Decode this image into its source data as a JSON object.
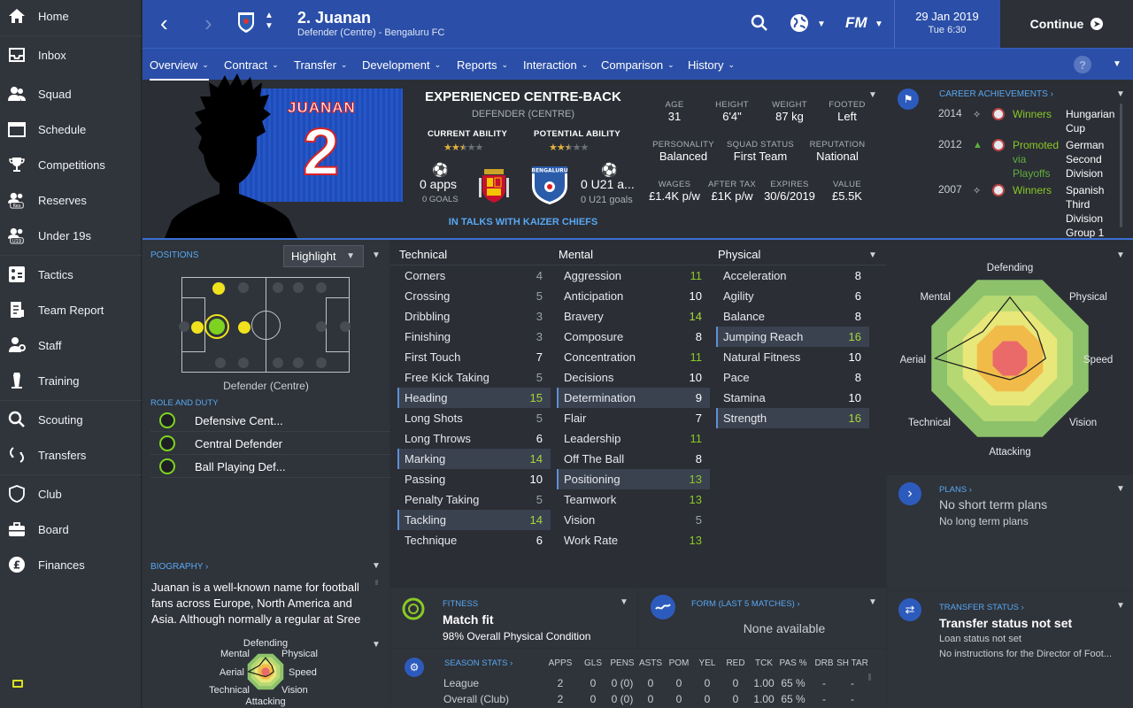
{
  "sidebar": {
    "items": [
      {
        "label": "Home",
        "icon": "home-icon"
      },
      {
        "label": "Inbox",
        "icon": "inbox-icon"
      },
      {
        "label": "Squad",
        "icon": "squad-icon"
      },
      {
        "label": "Schedule",
        "icon": "calendar-icon"
      },
      {
        "label": "Competitions",
        "icon": "trophy-icon"
      },
      {
        "label": "Reserves",
        "icon": "reserves-icon"
      },
      {
        "label": "Under 19s",
        "icon": "under19-icon"
      },
      {
        "label": "Tactics",
        "icon": "tactics-icon"
      },
      {
        "label": "Team Report",
        "icon": "report-icon"
      },
      {
        "label": "Staff",
        "icon": "staff-icon"
      },
      {
        "label": "Training",
        "icon": "training-icon"
      },
      {
        "label": "Scouting",
        "icon": "search-icon"
      },
      {
        "label": "Transfers",
        "icon": "transfers-icon"
      },
      {
        "label": "Club",
        "icon": "club-icon"
      },
      {
        "label": "Board",
        "icon": "board-icon"
      },
      {
        "label": "Finances",
        "icon": "finances-icon"
      }
    ],
    "icon_badges": {
      "reserves": "Res",
      "under19": "U19"
    }
  },
  "header": {
    "player_title": "2. Juanan",
    "player_subtitle": "Defender (Centre) - Bengaluru FC",
    "club_badge_text": "BENGALURU",
    "fm_logo": "FM",
    "date": "29 Jan 2019",
    "day_time": "Tue 6:30",
    "continue_label": "Continue",
    "help": "?"
  },
  "tabs": [
    "Overview",
    "Contract",
    "Transfer",
    "Development",
    "Reports",
    "Interaction",
    "Comparison",
    "History"
  ],
  "profile": {
    "shirt_name": "JUANAN",
    "shirt_number": "2",
    "role_title": "EXPERIENCED CENTRE-BACK",
    "position": "DEFENDER (CENTRE)",
    "current_ability_label": "CURRENT ABILITY",
    "potential_ability_label": "POTENTIAL ABILITY",
    "current_stars": 2.5,
    "potential_stars": 2.5,
    "apps": "0 apps",
    "goals": "0 GOALS",
    "u21_apps": "0 U21 a...",
    "u21_goals": "0 U21 goals",
    "national_team": "Spain",
    "club": "BENGALURU",
    "status_note": "IN TALKS WITH KAIZER CHIEFS"
  },
  "info": [
    {
      "label": "AGE",
      "value": "31"
    },
    {
      "label": "HEIGHT",
      "value": "6'4\""
    },
    {
      "label": "WEIGHT",
      "value": "87 kg"
    },
    {
      "label": "FOOTED",
      "value": "Left"
    },
    {
      "label": "PERSONALITY",
      "value": "Balanced"
    },
    {
      "label": "SQUAD STATUS",
      "value": "First Team"
    },
    {
      "label": "REPUTATION",
      "value": "National"
    },
    {
      "label": "WAGES",
      "value": "£1.4K p/w"
    },
    {
      "label": "AFTER TAX",
      "value": "£1K p/w"
    },
    {
      "label": "EXPIRES",
      "value": "30/6/2019"
    },
    {
      "label": "VALUE",
      "value": "£5.5K"
    }
  ],
  "achievements": {
    "title": "CAREER ACHIEVEMENTS",
    "items": [
      {
        "year": "2014",
        "result": "Winners",
        "competition": [
          "Hungarian",
          "Cup"
        ]
      },
      {
        "year": "2012",
        "result": [
          "Promoted",
          "via",
          "Playoffs"
        ],
        "competition": [
          "German",
          "Second",
          "Division"
        ]
      },
      {
        "year": "2007",
        "result": "Winners",
        "competition": [
          "Spanish",
          "Third",
          "Division",
          "Group 1"
        ]
      }
    ]
  },
  "positions": {
    "title": "POSITIONS",
    "dropdown": "Highlight",
    "caption": "Defender (Centre)"
  },
  "roles": {
    "title": "ROLE AND DUTY",
    "items": [
      {
        "role": "Defensive Cent...",
        "duty": "Defend"
      },
      {
        "role": "Central Defender",
        "duty": "Defend"
      },
      {
        "role": "Ball Playing Def...",
        "duty": "Defend"
      }
    ]
  },
  "biography": {
    "title": "BIOGRAPHY",
    "lines": [
      "Juanan is a well-known name for football",
      "fans across Europe, North America and",
      "Asia. Although normally a regular at Sree"
    ]
  },
  "attributes": {
    "technical": {
      "title": "Technical",
      "items": [
        {
          "name": "Corners",
          "value": 4
        },
        {
          "name": "Crossing",
          "value": 5
        },
        {
          "name": "Dribbling",
          "value": 3
        },
        {
          "name": "Finishing",
          "value": 3
        },
        {
          "name": "First Touch",
          "value": 7
        },
        {
          "name": "Free Kick Taking",
          "value": 5
        },
        {
          "name": "Heading",
          "value": 15
        },
        {
          "name": "Long Shots",
          "value": 5
        },
        {
          "name": "Long Throws",
          "value": 6
        },
        {
          "name": "Marking",
          "value": 14
        },
        {
          "name": "Passing",
          "value": 10
        },
        {
          "name": "Penalty Taking",
          "value": 5
        },
        {
          "name": "Tackling",
          "value": 14
        },
        {
          "name": "Technique",
          "value": 6
        }
      ]
    },
    "mental": {
      "title": "Mental",
      "items": [
        {
          "name": "Aggression",
          "value": 11
        },
        {
          "name": "Anticipation",
          "value": 10
        },
        {
          "name": "Bravery",
          "value": 14
        },
        {
          "name": "Composure",
          "value": 8
        },
        {
          "name": "Concentration",
          "value": 11
        },
        {
          "name": "Decisions",
          "value": 10
        },
        {
          "name": "Determination",
          "value": 9
        },
        {
          "name": "Flair",
          "value": 7
        },
        {
          "name": "Leadership",
          "value": 11
        },
        {
          "name": "Off The Ball",
          "value": 8
        },
        {
          "name": "Positioning",
          "value": 13
        },
        {
          "name": "Teamwork",
          "value": 13
        },
        {
          "name": "Vision",
          "value": 5
        },
        {
          "name": "Work Rate",
          "value": 13
        }
      ]
    },
    "physical": {
      "title": "Physical",
      "items": [
        {
          "name": "Acceleration",
          "value": 8
        },
        {
          "name": "Agility",
          "value": 6
        },
        {
          "name": "Balance",
          "value": 8
        },
        {
          "name": "Jumping Reach",
          "value": 16
        },
        {
          "name": "Natural Fitness",
          "value": 10
        },
        {
          "name": "Pace",
          "value": 8
        },
        {
          "name": "Stamina",
          "value": 10
        },
        {
          "name": "Strength",
          "value": 16
        }
      ]
    },
    "highlighted": [
      "Heading",
      "Marking",
      "Tackling",
      "Determination",
      "Positioning",
      "Jumping Reach",
      "Strength"
    ]
  },
  "radar": {
    "labels": [
      "Defending",
      "Physical",
      "Speed",
      "Vision",
      "Attacking",
      "Technical",
      "Aerial",
      "Mental"
    ],
    "values": [
      0.72,
      0.45,
      0.42,
      0.25,
      0.25,
      0.28,
      0.88,
      0.45
    ]
  },
  "fitness": {
    "title": "FITNESS",
    "heading": "Match fit",
    "detail": "98% Overall Physical Condition"
  },
  "form": {
    "title": "FORM (LAST 5 MATCHES)",
    "detail": "None available"
  },
  "season_stats": {
    "title": "SEASON STATS",
    "columns": [
      "APPS",
      "GLS",
      "PENS",
      "ASTS",
      "POM",
      "YEL",
      "RED",
      "TCK",
      "PAS %",
      "DRB",
      "SH TAR"
    ],
    "rows": [
      {
        "name": "League",
        "cells": [
          "2",
          "0",
          "0 (0)",
          "0",
          "0",
          "0",
          "0",
          "1.00",
          "65 %",
          "-",
          "-"
        ]
      },
      {
        "name": "Overall (Club)",
        "cells": [
          "2",
          "0",
          "0 (0)",
          "0",
          "0",
          "0",
          "0",
          "1.00",
          "65 %",
          "-",
          "-"
        ]
      }
    ]
  },
  "plans": {
    "title": "PLANS",
    "short": "No short term plans",
    "long": "No long term plans"
  },
  "transfer_status": {
    "title": "TRANSFER STATUS",
    "heading": "Transfer status not set",
    "loan": "Loan status not set",
    "instructions": "No instructions for the Director of Foot..."
  }
}
